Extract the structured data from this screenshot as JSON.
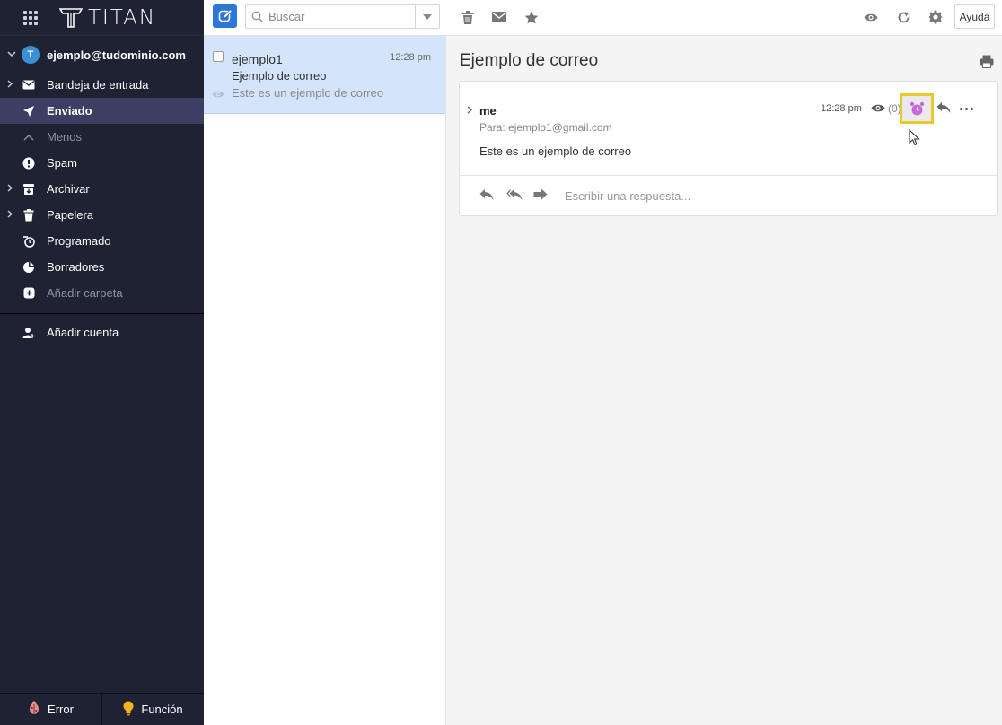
{
  "brand": {
    "name": "TITAN"
  },
  "account": {
    "initial": "T",
    "email": "ejemplo@tudominio.com"
  },
  "folders": [
    {
      "label": "Bandeja de entrada",
      "icon": "envelope-icon"
    },
    {
      "label": "Enviado",
      "icon": "paper-plane-icon",
      "active": true
    },
    {
      "label": "Menos",
      "icon": "chevron-up-icon"
    },
    {
      "label": "Spam",
      "icon": "exclamation-icon"
    },
    {
      "label": "Archivar",
      "icon": "archive-icon"
    },
    {
      "label": "Papelera",
      "icon": "trash-icon"
    },
    {
      "label": "Programado",
      "icon": "clock-send-icon"
    },
    {
      "label": "Borradores",
      "icon": "draft-icon"
    },
    {
      "label": "Añadir carpeta",
      "icon": "plus-circle-icon"
    }
  ],
  "add_account": {
    "label": "Añadir cuenta"
  },
  "bottom": {
    "error_label": "Error",
    "feature_label": "Función"
  },
  "toolbar": {
    "search_placeholder": "Buscar",
    "help_label": "Ayuda"
  },
  "message_list": {
    "items": [
      {
        "from": "ejemplo1",
        "time": "12:28 pm",
        "subject": "Ejemplo de correo",
        "preview": "Este es un ejemplo de correo"
      }
    ]
  },
  "reading": {
    "title": "Ejemplo de correo",
    "sender": "me",
    "to": "Para: ejemplo1@gmail.com",
    "time": "12:28 pm",
    "read_count": "(0)",
    "body": "Este es un ejemplo de correo",
    "reply_placeholder": "Escribir una respuesta..."
  },
  "colors": {
    "sidebar_bg": "#1f2232",
    "active_folder": "#3c3f63",
    "accent_blue": "#2c77d8",
    "selected_row": "#d4e5fb",
    "highlight_box": "#e6cb2a",
    "alarm_purple": "#c56bd8"
  }
}
